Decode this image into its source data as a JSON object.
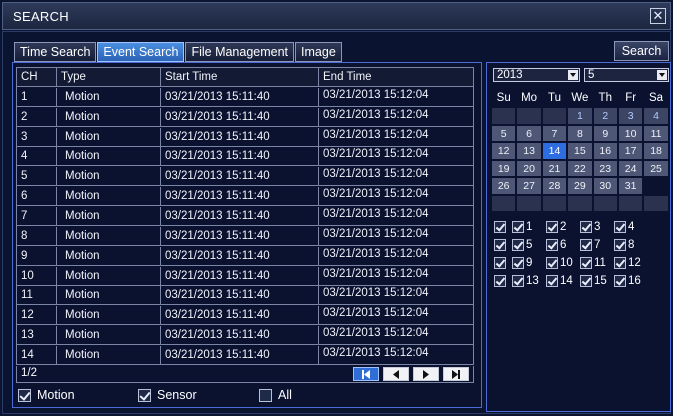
{
  "window": {
    "title": "SEARCH",
    "close_label": "✕"
  },
  "tabs": [
    "Time Search",
    "Event Search",
    "File Management",
    "Image"
  ],
  "active_tab": 1,
  "search_button": "Search",
  "table": {
    "headers": [
      "CH",
      "Type",
      "Start Time",
      "End Time"
    ],
    "rows": [
      [
        "1",
        "Motion",
        "03/21/2013 15:11:40",
        "03/21/2013 15:12:04"
      ],
      [
        "2",
        "Motion",
        "03/21/2013 15:11:40",
        "03/21/2013 15:12:04"
      ],
      [
        "3",
        "Motion",
        "03/21/2013 15:11:40",
        "03/21/2013 15:12:04"
      ],
      [
        "4",
        "Motion",
        "03/21/2013 15:11:40",
        "03/21/2013 15:12:04"
      ],
      [
        "5",
        "Motion",
        "03/21/2013 15:11:40",
        "03/21/2013 15:12:04"
      ],
      [
        "6",
        "Motion",
        "03/21/2013 15:11:40",
        "03/21/2013 15:12:04"
      ],
      [
        "7",
        "Motion",
        "03/21/2013 15:11:40",
        "03/21/2013 15:12:04"
      ],
      [
        "8",
        "Motion",
        "03/21/2013 15:11:40",
        "03/21/2013 15:12:04"
      ],
      [
        "9",
        "Motion",
        "03/21/2013 15:11:40",
        "03/21/2013 15:12:04"
      ],
      [
        "10",
        "Motion",
        "03/21/2013 15:11:40",
        "03/21/2013 15:12:04"
      ],
      [
        "11",
        "Motion",
        "03/21/2013 15:11:40",
        "03/21/2013 15:12:04"
      ],
      [
        "12",
        "Motion",
        "03/21/2013 15:11:40",
        "03/21/2013 15:12:04"
      ],
      [
        "13",
        "Motion",
        "03/21/2013 15:11:40",
        "03/21/2013 15:12:04"
      ],
      [
        "14",
        "Motion",
        "03/21/2013 15:11:40",
        "03/21/2013 15:12:04"
      ]
    ]
  },
  "pager": {
    "page": "1/2",
    "buttons": [
      "first-page-icon",
      "prev-page-icon",
      "next-page-icon",
      "last-page-icon"
    ]
  },
  "filters": [
    {
      "label": "Motion",
      "checked": true
    },
    {
      "label": "Sensor",
      "checked": true
    },
    {
      "label": "All",
      "checked": false
    }
  ],
  "calendar": {
    "year": "2013",
    "month": "5",
    "weekdays": [
      "Su",
      "Mo",
      "Tu",
      "We",
      "Th",
      "Fr",
      "Sa"
    ],
    "weeks": [
      [
        {
          "d": "",
          "s": "empty"
        },
        {
          "d": "",
          "s": "empty"
        },
        {
          "d": "",
          "s": "empty"
        },
        {
          "d": "1",
          "s": "cur"
        },
        {
          "d": "2",
          "s": "cur"
        },
        {
          "d": "3",
          "s": "cur"
        },
        {
          "d": "4",
          "s": "cur"
        }
      ],
      [
        {
          "d": "5",
          "s": "rec"
        },
        {
          "d": "6",
          "s": "rec"
        },
        {
          "d": "7",
          "s": "rec"
        },
        {
          "d": "8",
          "s": "rec"
        },
        {
          "d": "9",
          "s": "rec"
        },
        {
          "d": "10",
          "s": "rec"
        },
        {
          "d": "11",
          "s": "rec"
        }
      ],
      [
        {
          "d": "12",
          "s": "rec"
        },
        {
          "d": "13",
          "s": "rec"
        },
        {
          "d": "14",
          "s": "sel"
        },
        {
          "d": "15",
          "s": "rec"
        },
        {
          "d": "16",
          "s": "rec"
        },
        {
          "d": "17",
          "s": "rec"
        },
        {
          "d": "18",
          "s": "rec"
        }
      ],
      [
        {
          "d": "19",
          "s": "rec"
        },
        {
          "d": "20",
          "s": "rec"
        },
        {
          "d": "21",
          "s": "rec"
        },
        {
          "d": "22",
          "s": "rec"
        },
        {
          "d": "23",
          "s": "rec"
        },
        {
          "d": "24",
          "s": "rec"
        },
        {
          "d": "25",
          "s": "rec"
        }
      ],
      [
        {
          "d": "26",
          "s": "rec"
        },
        {
          "d": "27",
          "s": "rec"
        },
        {
          "d": "28",
          "s": "rec"
        },
        {
          "d": "29",
          "s": "rec"
        },
        {
          "d": "30",
          "s": "rec"
        },
        {
          "d": "31",
          "s": "rec"
        },
        {
          "d": "",
          "s": "dark"
        }
      ],
      [
        {
          "d": "",
          "s": "empty"
        },
        {
          "d": "",
          "s": "empty"
        },
        {
          "d": "",
          "s": "empty"
        },
        {
          "d": "",
          "s": "empty"
        },
        {
          "d": "",
          "s": "empty"
        },
        {
          "d": "",
          "s": "empty"
        },
        {
          "d": "",
          "s": "empty"
        }
      ]
    ]
  },
  "channels": {
    "rows": [
      [
        "1",
        "2",
        "3",
        "4"
      ],
      [
        "5",
        "6",
        "7",
        "8"
      ],
      [
        "9",
        "10",
        "11",
        "12"
      ],
      [
        "13",
        "14",
        "15",
        "16"
      ]
    ],
    "all_checked": true,
    "checked": true
  },
  "colors": {
    "background": "#0a1230",
    "accent": "#2e6de0",
    "border": "#4d6bd6"
  }
}
